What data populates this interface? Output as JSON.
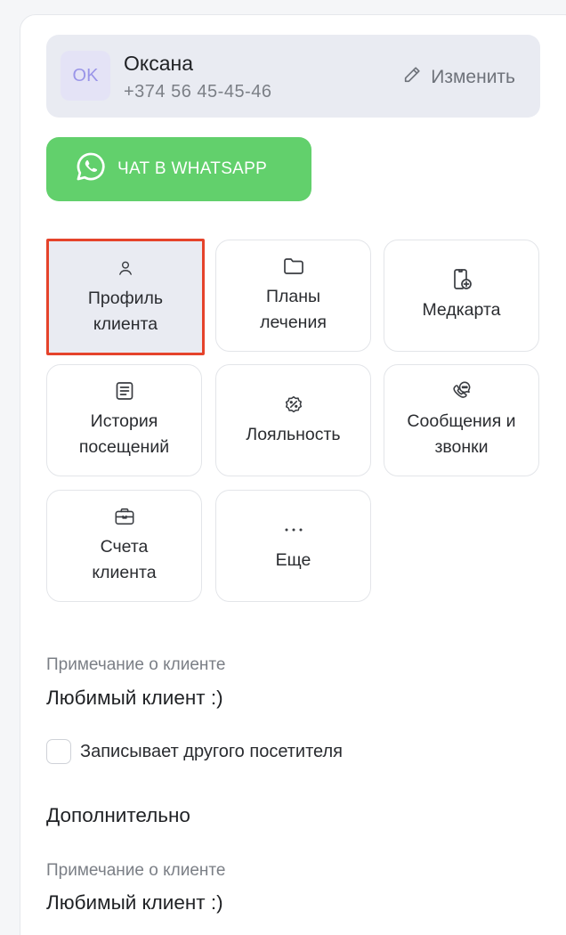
{
  "client": {
    "initials": "OK",
    "name": "Оксана",
    "phone": "+374 56 45-45-46",
    "edit_label": "Изменить"
  },
  "whatsapp": {
    "label": "ЧАТ В WHATSAPP",
    "color": "#62d06c"
  },
  "tiles": [
    {
      "id": "profile",
      "label": "Профиль\nклиента",
      "icon": "user-icon",
      "selected": true
    },
    {
      "id": "plans",
      "label": "Планы\nлечения",
      "icon": "folder-icon",
      "selected": false
    },
    {
      "id": "medcard",
      "label": "Медкарта",
      "icon": "medical-card-icon",
      "selected": false
    },
    {
      "id": "history",
      "label": "История\nпосещений",
      "icon": "list-icon",
      "selected": false
    },
    {
      "id": "loyalty",
      "label": "Лояльность",
      "icon": "discount-badge-icon",
      "selected": false
    },
    {
      "id": "messages",
      "label": "Сообщения и\nзвонки",
      "icon": "phone-chat-icon",
      "selected": false
    },
    {
      "id": "invoices",
      "label": "Счета\nклиента",
      "icon": "briefcase-icon",
      "selected": false
    },
    {
      "id": "more",
      "label": "Еще",
      "icon": "more-dots-icon",
      "selected": false
    }
  ],
  "note1": {
    "label": "Примечание о клиенте",
    "value": "Любимый клиент :)"
  },
  "checkbox": {
    "label": "Записывает другого посетителя",
    "checked": false
  },
  "extra": {
    "title": "Дополнительно",
    "note_label": "Примечание о клиенте",
    "note_value": "Любимый клиент :)"
  },
  "colors": {
    "accent_selected_border": "#e5432b",
    "card_bg": "#e9ebf2"
  }
}
